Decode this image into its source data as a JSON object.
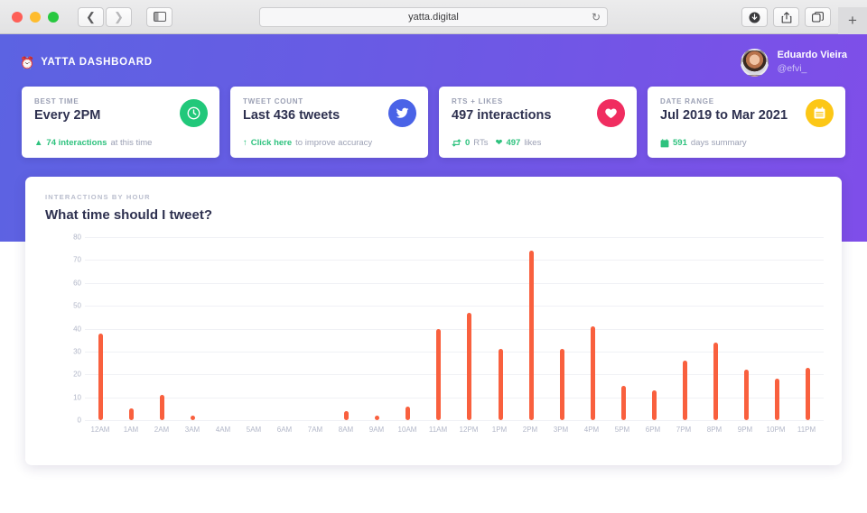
{
  "browser": {
    "url": "yatta.digital",
    "back_icon": "chevron-left-icon",
    "forward_icon": "chevron-right-icon",
    "sidebar_icon": "sidebar-toggle-icon",
    "reload_icon": "reload-icon",
    "download_icon": "download-icon",
    "share_icon": "share-icon",
    "tabs_icon": "tab-overview-icon",
    "new_tab_label": "+"
  },
  "header": {
    "brand_emoji": "⏰",
    "brand_text": "YATTA DASHBOARD",
    "user": {
      "name": "Eduardo Vieira",
      "handle": "@efvi_"
    }
  },
  "cards": [
    {
      "label": "BEST TIME",
      "value": "Every 2PM",
      "foot_icon": "arrow-up-icon",
      "foot_highlight": "74 interactions",
      "foot_muted": "at this time",
      "badge_icon": "clock-icon",
      "badge_color": "#21c87a"
    },
    {
      "label": "TWEET COUNT",
      "value": "Last 436 tweets",
      "foot_icon": "arrow-up-icon",
      "foot_highlight": "Click here",
      "foot_muted": "to improve accuracy",
      "badge_icon": "twitter-icon",
      "badge_color": "#4a63e7"
    },
    {
      "label": "RTS + LIKES",
      "value": "497 interactions",
      "foot_icon": "retweet-icon",
      "foot_highlight": "0",
      "foot_muted": "RTs",
      "foot_icon2": "heart-icon",
      "foot_highlight2": "497",
      "foot_muted2": "likes",
      "badge_icon": "heart-icon",
      "badge_color": "#f02d60"
    },
    {
      "label": "DATE RANGE",
      "value": "Jul 2019 to Mar 2021",
      "foot_icon": "calendar-icon",
      "foot_highlight": "591",
      "foot_muted": "days summary",
      "badge_icon": "calendar-icon",
      "badge_color": "#fcc716"
    }
  ],
  "chart_panel": {
    "kicker": "INTERACTIONS BY HOUR",
    "title": "What time should I tweet?"
  },
  "chart_data": {
    "type": "bar",
    "title": "What time should I tweet?",
    "subtitle": "INTERACTIONS BY HOUR",
    "xlabel": "",
    "ylabel": "",
    "ylim": [
      0,
      80
    ],
    "yticks": [
      0,
      10,
      20,
      30,
      40,
      50,
      60,
      70,
      80
    ],
    "grid": true,
    "legend": "none",
    "bar_color": "#f9603e",
    "categories": [
      "12AM",
      "1AM",
      "2AM",
      "3AM",
      "4AM",
      "5AM",
      "6AM",
      "7AM",
      "8AM",
      "9AM",
      "10AM",
      "11AM",
      "12PM",
      "1PM",
      "2PM",
      "3PM",
      "4PM",
      "5PM",
      "6PM",
      "7PM",
      "8PM",
      "9PM",
      "10PM",
      "11PM"
    ],
    "values": [
      38,
      5,
      11,
      2,
      0,
      0,
      0,
      0,
      4,
      2,
      6,
      40,
      47,
      31,
      74,
      31,
      41,
      15,
      13,
      26,
      34,
      22,
      18,
      23
    ]
  }
}
